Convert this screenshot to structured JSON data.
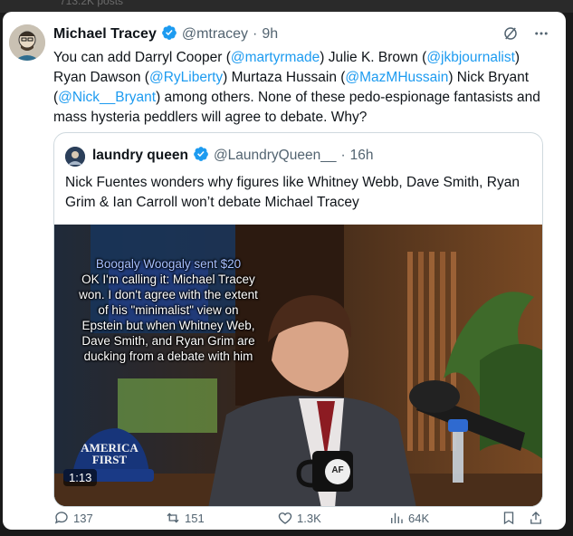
{
  "header_fragment": "713.2K posts",
  "tweet": {
    "author_name": "Michael Tracey",
    "handle": "@mtracey",
    "separator": "·",
    "time": "9h",
    "text_parts": [
      {
        "t": "You can add Darryl Cooper (",
        "m": false
      },
      {
        "t": "@martyrmade",
        "m": true
      },
      {
        "t": ") Julie K. Brown (",
        "m": false
      },
      {
        "t": "@jkbjournalist",
        "m": true
      },
      {
        "t": ") Ryan Dawson (",
        "m": false
      },
      {
        "t": "@RyLiberty",
        "m": true
      },
      {
        "t": ") Murtaza Hussain (",
        "m": false
      },
      {
        "t": "@MazMHussain",
        "m": true
      },
      {
        "t": ") Nick Bryant (",
        "m": false
      },
      {
        "t": "@Nick__Bryant",
        "m": true
      },
      {
        "t": ") among others. None of these pedo-espionage fantasists and mass hysteria peddlers will agree to debate. Why?",
        "m": false
      }
    ]
  },
  "quote": {
    "author_name": "laundry queen",
    "handle": "@LaundryQueen__",
    "separator": "·",
    "time": "16h",
    "text": "Nick Fuentes wonders why figures like Whitney Webb, Dave Smith, Ryan Grim & Ian Carroll won’t debate Michael Tracey",
    "video": {
      "donation_line": "Boogaly Woogaly sent $20",
      "overlay_lines": [
        "OK I'm calling it: Michael Tracey",
        "won. I don't agree with the extent",
        "of his \"minimalist\" view on",
        "Epstein but when Whitney Web,",
        "Dave Smith, and Ryan Grim are",
        "ducking from a debate with him"
      ],
      "duration": "1:13",
      "hat_text_1": "AMERICA",
      "hat_text_2": "FIRST",
      "mug_text": "AF"
    }
  },
  "actions": {
    "replies": "137",
    "reposts": "151",
    "likes": "1.3K",
    "views": "64K"
  },
  "colors": {
    "accent": "#1d9bf0",
    "text": "#0f1419",
    "muted": "#536471"
  }
}
